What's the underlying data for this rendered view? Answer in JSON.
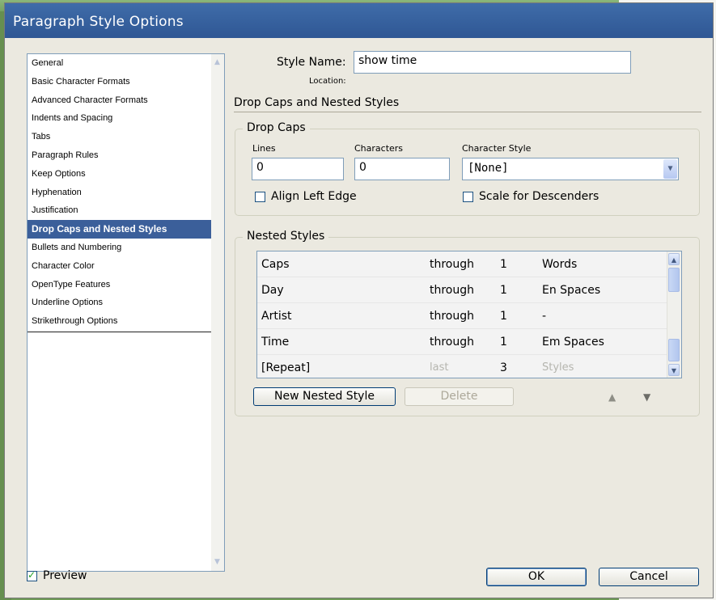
{
  "window": {
    "title": "Paragraph Style Options"
  },
  "categories": [
    "General",
    "Basic Character Formats",
    "Advanced Character Formats",
    "Indents and Spacing",
    "Tabs",
    "Paragraph Rules",
    "Keep Options",
    "Hyphenation",
    "Justification",
    "Drop Caps and Nested Styles",
    "Bullets and Numbering",
    "Character Color",
    "OpenType Features",
    "Underline Options",
    "Strikethrough Options"
  ],
  "selected_category": "Drop Caps and Nested Styles",
  "style_name": {
    "label": "Style Name:",
    "value": "show time"
  },
  "location_label": "Location:",
  "section_title": "Drop Caps and Nested Styles",
  "drop_caps": {
    "title": "Drop Caps",
    "lines_label": "Lines",
    "lines_value": "0",
    "characters_label": "Characters",
    "characters_value": "0",
    "char_style_label": "Character Style",
    "char_style_value": "[None]",
    "align_left_edge": {
      "label": "Align Left Edge",
      "checked": false
    },
    "scale_descenders": {
      "label": "Scale for Descenders",
      "checked": false
    }
  },
  "nested_styles": {
    "title": "Nested Styles",
    "rows": [
      {
        "style": "Caps",
        "mode": "through",
        "count": "1",
        "unit": "Words"
      },
      {
        "style": "Day",
        "mode": "through",
        "count": "1",
        "unit": "En Spaces"
      },
      {
        "style": "Artist",
        "mode": "through",
        "count": "1",
        "unit": "-"
      },
      {
        "style": "Time",
        "mode": "through",
        "count": "1",
        "unit": "Em Spaces"
      },
      {
        "style": "[Repeat]",
        "mode": "last",
        "count": "3",
        "unit": "Styles"
      }
    ],
    "new_button": "New Nested Style",
    "delete_button": "Delete"
  },
  "preview": {
    "label": "Preview",
    "checked": true
  },
  "ok_button": "OK",
  "cancel_button": "Cancel",
  "colors": {
    "title_bar": "#2f5794",
    "selection": "#3b5f9a",
    "desktop": "#6f9a57"
  }
}
